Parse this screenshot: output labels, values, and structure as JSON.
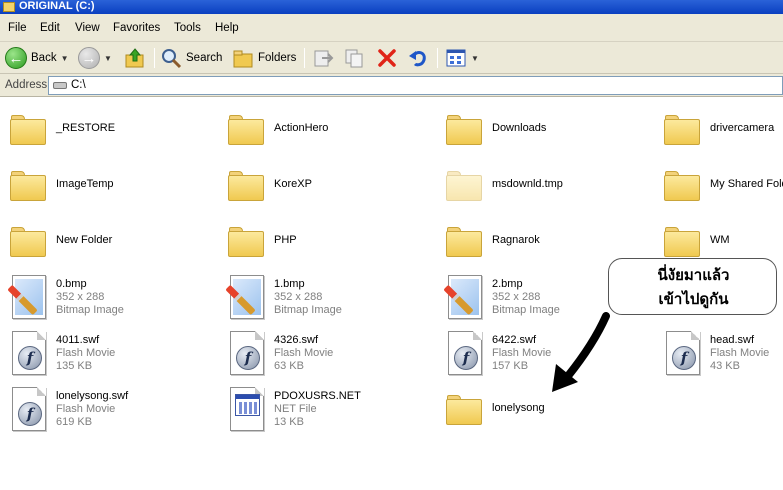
{
  "window": {
    "title": "ORIGINAL (C:)"
  },
  "menu": [
    "File",
    "Edit",
    "View",
    "Favorites",
    "Tools",
    "Help"
  ],
  "toolbar": {
    "back_label": "Back",
    "search_label": "Search",
    "folders_label": "Folders"
  },
  "address": {
    "label": "Address",
    "value": "C:\\"
  },
  "items": [
    {
      "type": "folder",
      "name": "_RESTORE"
    },
    {
      "type": "folder",
      "name": "ActionHero"
    },
    {
      "type": "folder",
      "name": "Downloads"
    },
    {
      "type": "folder",
      "name": "drivercamera"
    },
    {
      "type": "folder",
      "name": "ImageTemp"
    },
    {
      "type": "folder",
      "name": "KoreXP"
    },
    {
      "type": "folder",
      "name": "msdownld.tmp",
      "faded": true
    },
    {
      "type": "folder",
      "name": "My Shared Fold"
    },
    {
      "type": "folder",
      "name": "New Folder"
    },
    {
      "type": "folder",
      "name": "PHP"
    },
    {
      "type": "folder",
      "name": "Ragnarok"
    },
    {
      "type": "folder",
      "name": "WM"
    },
    {
      "type": "bmp",
      "name": "0.bmp",
      "line2": "352 x 288",
      "line3": "Bitmap Image"
    },
    {
      "type": "bmp",
      "name": "1.bmp",
      "line2": "352 x 288",
      "line3": "Bitmap Image"
    },
    {
      "type": "bmp",
      "name": "2.bmp",
      "line2": "352 x 288",
      "line3": "Bitmap Image"
    },
    {
      "type": "hidden",
      "name": ""
    },
    {
      "type": "swf",
      "name": "4011.swf",
      "line2": "Flash Movie",
      "line3": "135 KB"
    },
    {
      "type": "swf",
      "name": "4326.swf",
      "line2": "Flash Movie",
      "line3": "63 KB"
    },
    {
      "type": "swf",
      "name": "6422.swf",
      "line2": "Flash Movie",
      "line3": "157 KB"
    },
    {
      "type": "swf",
      "name": "head.swf",
      "line2": "Flash Movie",
      "line3": "43 KB"
    },
    {
      "type": "swf",
      "name": "lonelysong.swf",
      "line2": "Flash Movie",
      "line3": "619 KB"
    },
    {
      "type": "net",
      "name": "PDOXUSRS.NET",
      "line2": "NET File",
      "line3": "13 KB"
    },
    {
      "type": "folder",
      "name": "lonelysong"
    }
  ],
  "annotation": {
    "line1": "นี่งัยมาแล้ว",
    "line2": "เข้าไปดูกัน"
  },
  "colors": {
    "titlebar": "#0a3fc0",
    "chrome": "#ece9d8",
    "folder": "#f0c950"
  }
}
